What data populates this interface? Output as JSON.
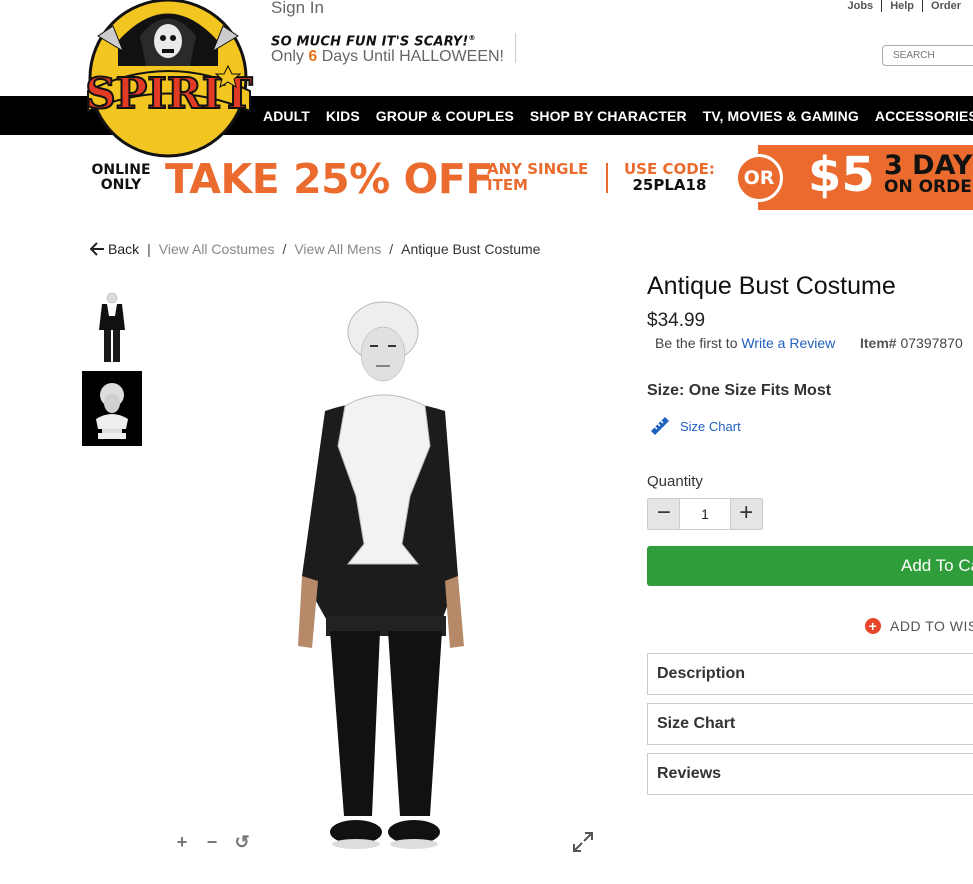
{
  "header": {
    "sign_in": "Sign In",
    "tagline": "SO MUCH FUN IT'S SCARY!",
    "tagline_mark": "®",
    "countdown_prefix": "Only",
    "countdown_days": "6",
    "countdown_suffix": "Days Until HALLOWEEN!",
    "top_links": [
      "Jobs",
      "Help",
      "Order"
    ],
    "search_placeholder": "SEARCH",
    "logo_text": "SPIRIT"
  },
  "nav": {
    "items": [
      "ADULT",
      "KIDS",
      "GROUP & COUPLES",
      "SHOP BY CHARACTER",
      "TV, MOVIES & GAMING",
      "ACCESSORIES"
    ]
  },
  "promo": {
    "online_only": "ONLINE ONLY",
    "offer": "TAKE 25% OFF",
    "any_single_item": "ANY SINGLE ITEM",
    "use_code_label": "USE CODE:",
    "code": "25PLA18",
    "or": "OR",
    "five": "$5",
    "three_day": "3 DAY",
    "on_order": "ON ORDE"
  },
  "breadcrumb": {
    "back": "Back",
    "items": [
      "View All Costumes",
      "View All Mens",
      "Antique Bust Costume"
    ]
  },
  "product": {
    "title": "Antique Bust Costume",
    "price": "$34.99",
    "review_prefix": "Be the first to",
    "review_link": "Write a Review",
    "item_label": "Item#",
    "item_number": "07397870",
    "size_label": "Size:",
    "size_value": "One Size Fits Most",
    "size_chart_link": "Size Chart",
    "quantity_label": "Quantity",
    "quantity_value": "1",
    "add_to_cart": "Add To Ca",
    "add_to_wishlist": "ADD TO WIS",
    "accordions": [
      "Description",
      "Size Chart",
      "Reviews"
    ]
  },
  "colors": {
    "nav_bg": "#000000",
    "promo_orange": "#ea6b2d",
    "link_blue": "#1f5fbf",
    "cart_green": "#2f9e3a",
    "wish_red": "#e8462a"
  }
}
